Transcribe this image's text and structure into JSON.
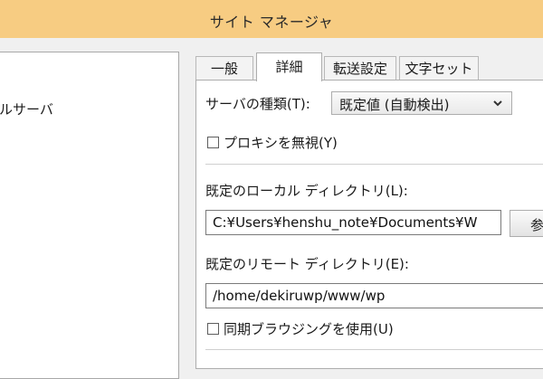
{
  "window": {
    "title": "サイト マネージャ"
  },
  "site_tree": {
    "item_label": "ルサーバ"
  },
  "tabs": [
    {
      "label": "一般"
    },
    {
      "label": "詳細",
      "active": true
    },
    {
      "label": "転送設定"
    },
    {
      "label": "文字セット"
    }
  ],
  "advanced": {
    "server_type_label": "サーバの種類(T):",
    "server_type_value": "既定値 (自動検出)",
    "bypass_proxy_label": "プロキシを無視(Y)",
    "bypass_proxy_checked": false,
    "local_dir_label": "既定のローカル ディレクトリ(L):",
    "local_dir_value": "C:¥Users¥henshu_note¥Documents¥W",
    "browse_label": "参照",
    "remote_dir_label": "既定のリモート ディレクトリ(E):",
    "remote_dir_value": "/home/dekiruwp/www/wp",
    "sync_browsing_label": "同期ブラウジングを使用(U)",
    "sync_browsing_checked": false
  },
  "colors": {
    "titlebar": "#f7cc82",
    "window_bg": "#f0f0f0",
    "panel_bg": "#ffffff",
    "border": "#adadad"
  },
  "icons": {
    "dropdown": "chevron-down-icon"
  }
}
